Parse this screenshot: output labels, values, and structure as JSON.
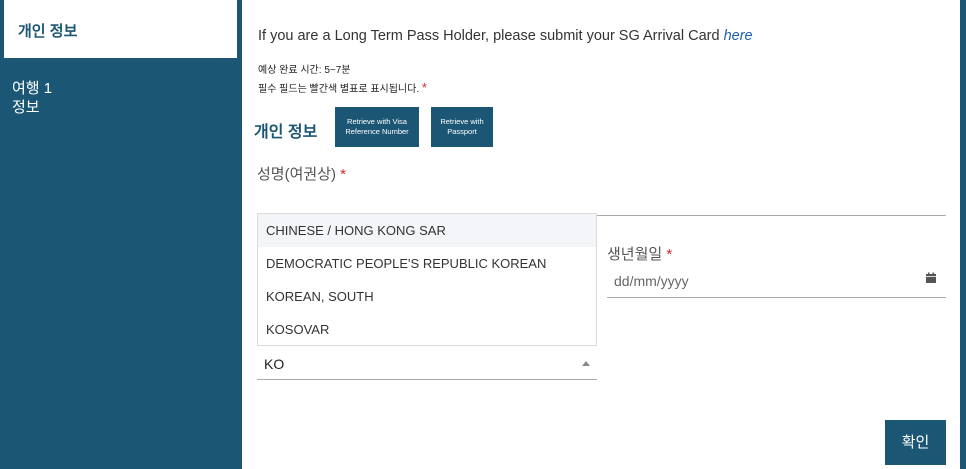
{
  "sidebar": {
    "active_item": "개인 정보",
    "items": [
      {
        "line1": "여행 1",
        "line2": "정보"
      }
    ]
  },
  "main": {
    "notice_text": "If you are a Long Term Pass Holder, please submit your SG Arrival Card ",
    "notice_link": "here",
    "estimated_time": "예상 완료 시간: 5~7분",
    "required_note": "필수 필드는 빨간색 별표로 표시됩니다.",
    "required_mark": "*",
    "section_title": "개인 정보",
    "retrieve_visa": {
      "line1": "Retrieve with Visa",
      "line2": "Reference Number"
    },
    "retrieve_passport": {
      "line1": "Retrieve with",
      "line2": "Passport"
    },
    "name_label": "성명(여권상)",
    "nationality_options": [
      "CHINESE / HONG KONG SAR",
      "DEMOCRATIC PEOPLE'S REPUBLIC KOREAN",
      "KOREAN, SOUTH",
      "KOSOVAR"
    ],
    "nationality_value": "KO",
    "dob_label": "생년월일",
    "dob_placeholder": "dd/mm/yyyy",
    "confirm_label": "확인"
  },
  "colors": {
    "primary": "#1b5775",
    "required": "#d9262c",
    "link": "#1f5fb0"
  }
}
